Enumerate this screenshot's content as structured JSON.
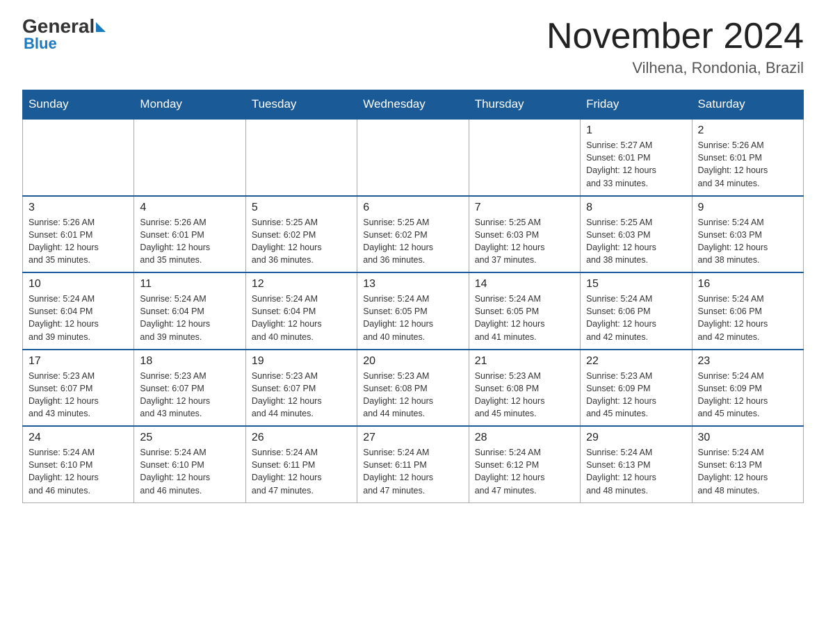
{
  "header": {
    "logo_general": "General",
    "logo_blue": "Blue",
    "month": "November 2024",
    "location": "Vilhena, Rondonia, Brazil"
  },
  "days_of_week": [
    "Sunday",
    "Monday",
    "Tuesday",
    "Wednesday",
    "Thursday",
    "Friday",
    "Saturday"
  ],
  "weeks": [
    [
      {
        "day": "",
        "info": ""
      },
      {
        "day": "",
        "info": ""
      },
      {
        "day": "",
        "info": ""
      },
      {
        "day": "",
        "info": ""
      },
      {
        "day": "",
        "info": ""
      },
      {
        "day": "1",
        "info": "Sunrise: 5:27 AM\nSunset: 6:01 PM\nDaylight: 12 hours\nand 33 minutes."
      },
      {
        "day": "2",
        "info": "Sunrise: 5:26 AM\nSunset: 6:01 PM\nDaylight: 12 hours\nand 34 minutes."
      }
    ],
    [
      {
        "day": "3",
        "info": "Sunrise: 5:26 AM\nSunset: 6:01 PM\nDaylight: 12 hours\nand 35 minutes."
      },
      {
        "day": "4",
        "info": "Sunrise: 5:26 AM\nSunset: 6:01 PM\nDaylight: 12 hours\nand 35 minutes."
      },
      {
        "day": "5",
        "info": "Sunrise: 5:25 AM\nSunset: 6:02 PM\nDaylight: 12 hours\nand 36 minutes."
      },
      {
        "day": "6",
        "info": "Sunrise: 5:25 AM\nSunset: 6:02 PM\nDaylight: 12 hours\nand 36 minutes."
      },
      {
        "day": "7",
        "info": "Sunrise: 5:25 AM\nSunset: 6:03 PM\nDaylight: 12 hours\nand 37 minutes."
      },
      {
        "day": "8",
        "info": "Sunrise: 5:25 AM\nSunset: 6:03 PM\nDaylight: 12 hours\nand 38 minutes."
      },
      {
        "day": "9",
        "info": "Sunrise: 5:24 AM\nSunset: 6:03 PM\nDaylight: 12 hours\nand 38 minutes."
      }
    ],
    [
      {
        "day": "10",
        "info": "Sunrise: 5:24 AM\nSunset: 6:04 PM\nDaylight: 12 hours\nand 39 minutes."
      },
      {
        "day": "11",
        "info": "Sunrise: 5:24 AM\nSunset: 6:04 PM\nDaylight: 12 hours\nand 39 minutes."
      },
      {
        "day": "12",
        "info": "Sunrise: 5:24 AM\nSunset: 6:04 PM\nDaylight: 12 hours\nand 40 minutes."
      },
      {
        "day": "13",
        "info": "Sunrise: 5:24 AM\nSunset: 6:05 PM\nDaylight: 12 hours\nand 40 minutes."
      },
      {
        "day": "14",
        "info": "Sunrise: 5:24 AM\nSunset: 6:05 PM\nDaylight: 12 hours\nand 41 minutes."
      },
      {
        "day": "15",
        "info": "Sunrise: 5:24 AM\nSunset: 6:06 PM\nDaylight: 12 hours\nand 42 minutes."
      },
      {
        "day": "16",
        "info": "Sunrise: 5:24 AM\nSunset: 6:06 PM\nDaylight: 12 hours\nand 42 minutes."
      }
    ],
    [
      {
        "day": "17",
        "info": "Sunrise: 5:23 AM\nSunset: 6:07 PM\nDaylight: 12 hours\nand 43 minutes."
      },
      {
        "day": "18",
        "info": "Sunrise: 5:23 AM\nSunset: 6:07 PM\nDaylight: 12 hours\nand 43 minutes."
      },
      {
        "day": "19",
        "info": "Sunrise: 5:23 AM\nSunset: 6:07 PM\nDaylight: 12 hours\nand 44 minutes."
      },
      {
        "day": "20",
        "info": "Sunrise: 5:23 AM\nSunset: 6:08 PM\nDaylight: 12 hours\nand 44 minutes."
      },
      {
        "day": "21",
        "info": "Sunrise: 5:23 AM\nSunset: 6:08 PM\nDaylight: 12 hours\nand 45 minutes."
      },
      {
        "day": "22",
        "info": "Sunrise: 5:23 AM\nSunset: 6:09 PM\nDaylight: 12 hours\nand 45 minutes."
      },
      {
        "day": "23",
        "info": "Sunrise: 5:24 AM\nSunset: 6:09 PM\nDaylight: 12 hours\nand 45 minutes."
      }
    ],
    [
      {
        "day": "24",
        "info": "Sunrise: 5:24 AM\nSunset: 6:10 PM\nDaylight: 12 hours\nand 46 minutes."
      },
      {
        "day": "25",
        "info": "Sunrise: 5:24 AM\nSunset: 6:10 PM\nDaylight: 12 hours\nand 46 minutes."
      },
      {
        "day": "26",
        "info": "Sunrise: 5:24 AM\nSunset: 6:11 PM\nDaylight: 12 hours\nand 47 minutes."
      },
      {
        "day": "27",
        "info": "Sunrise: 5:24 AM\nSunset: 6:11 PM\nDaylight: 12 hours\nand 47 minutes."
      },
      {
        "day": "28",
        "info": "Sunrise: 5:24 AM\nSunset: 6:12 PM\nDaylight: 12 hours\nand 47 minutes."
      },
      {
        "day": "29",
        "info": "Sunrise: 5:24 AM\nSunset: 6:13 PM\nDaylight: 12 hours\nand 48 minutes."
      },
      {
        "day": "30",
        "info": "Sunrise: 5:24 AM\nSunset: 6:13 PM\nDaylight: 12 hours\nand 48 minutes."
      }
    ]
  ]
}
